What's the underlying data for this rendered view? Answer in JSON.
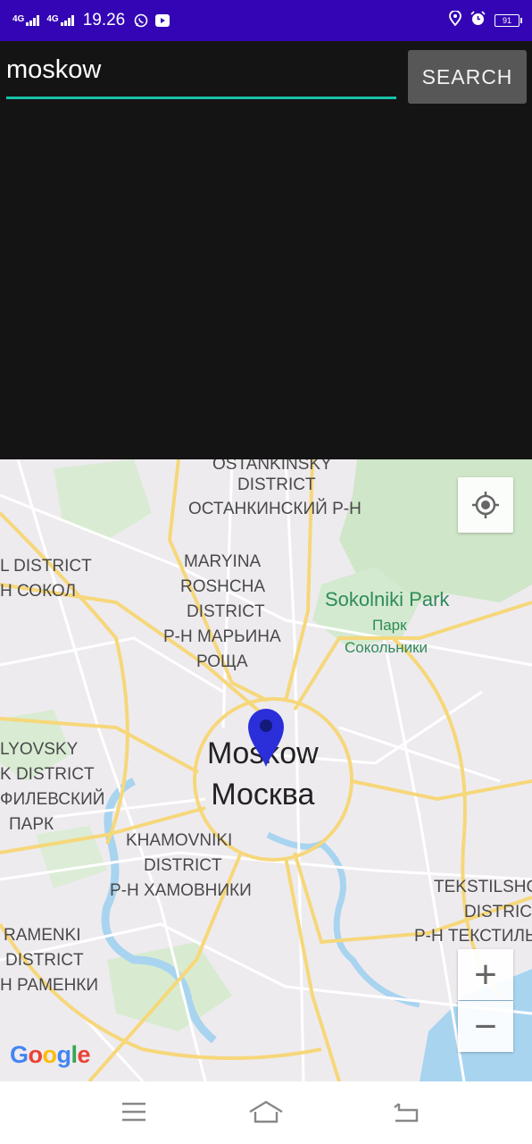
{
  "status_bar": {
    "network_1": "4G",
    "network_2": "4G",
    "time": "19.26",
    "battery": "91",
    "icons": [
      "signal-icon",
      "signal-icon",
      "whatsapp-icon",
      "youtube-icon",
      "location-icon",
      "alarm-icon",
      "battery-icon"
    ]
  },
  "search": {
    "value": "moskow",
    "button_label": "SEARCH",
    "accent_color": "#17c1a6"
  },
  "map": {
    "city_label_en": "Moskow",
    "city_label_ru": "Москва",
    "marker_color": "#2a2fd9",
    "labels": {
      "ostankinsky_1": "OSTANKINSKY",
      "ostankinsky_2": "DISTRICT",
      "ostankinsky_ru": "ОСТАНКИНСКИЙ Р-Н",
      "sokol_1": "L DISTRICT",
      "sokol_ru": "Н СОКОЛ",
      "maryina_1": "MARYINA",
      "maryina_2": "ROSHCHA",
      "maryina_3": "DISTRICT",
      "maryina_ru_1": "Р-Н МАРЬИНА",
      "maryina_ru_2": "РОЩА",
      "sokolniki_en": "Sokolniki Park",
      "sokolniki_ru_1": "Парк",
      "sokolniki_ru_2": "Сокольники",
      "filyovsky_1": "LYOVSKY",
      "filyovsky_2": "K DISTRICT",
      "filyovsky_ru_1": "ФИЛЕВСКИЙ",
      "filyovsky_ru_2": "ПАРК",
      "khamovniki_1": "KHAMOVNIKI",
      "khamovniki_2": "DISTRICT",
      "khamovniki_ru": "Р-Н ХАМОВНИКИ",
      "tekstil_1": "TEKSTILSHC",
      "tekstil_2": "DISTRIC",
      "tekstil_ru": "Р-Н ТЕКСТИЛЬ",
      "ramenki_1": "RAMENKI",
      "ramenki_2": "DISTRICT",
      "ramenki_ru": "Н РАМЕНКИ"
    },
    "zoom_in": "+",
    "zoom_out": "−",
    "google_logo": [
      "G",
      "o",
      "o",
      "g",
      "l",
      "e"
    ]
  },
  "nav_bar": {
    "icons": [
      "menu-icon",
      "home-icon",
      "back-icon"
    ]
  }
}
